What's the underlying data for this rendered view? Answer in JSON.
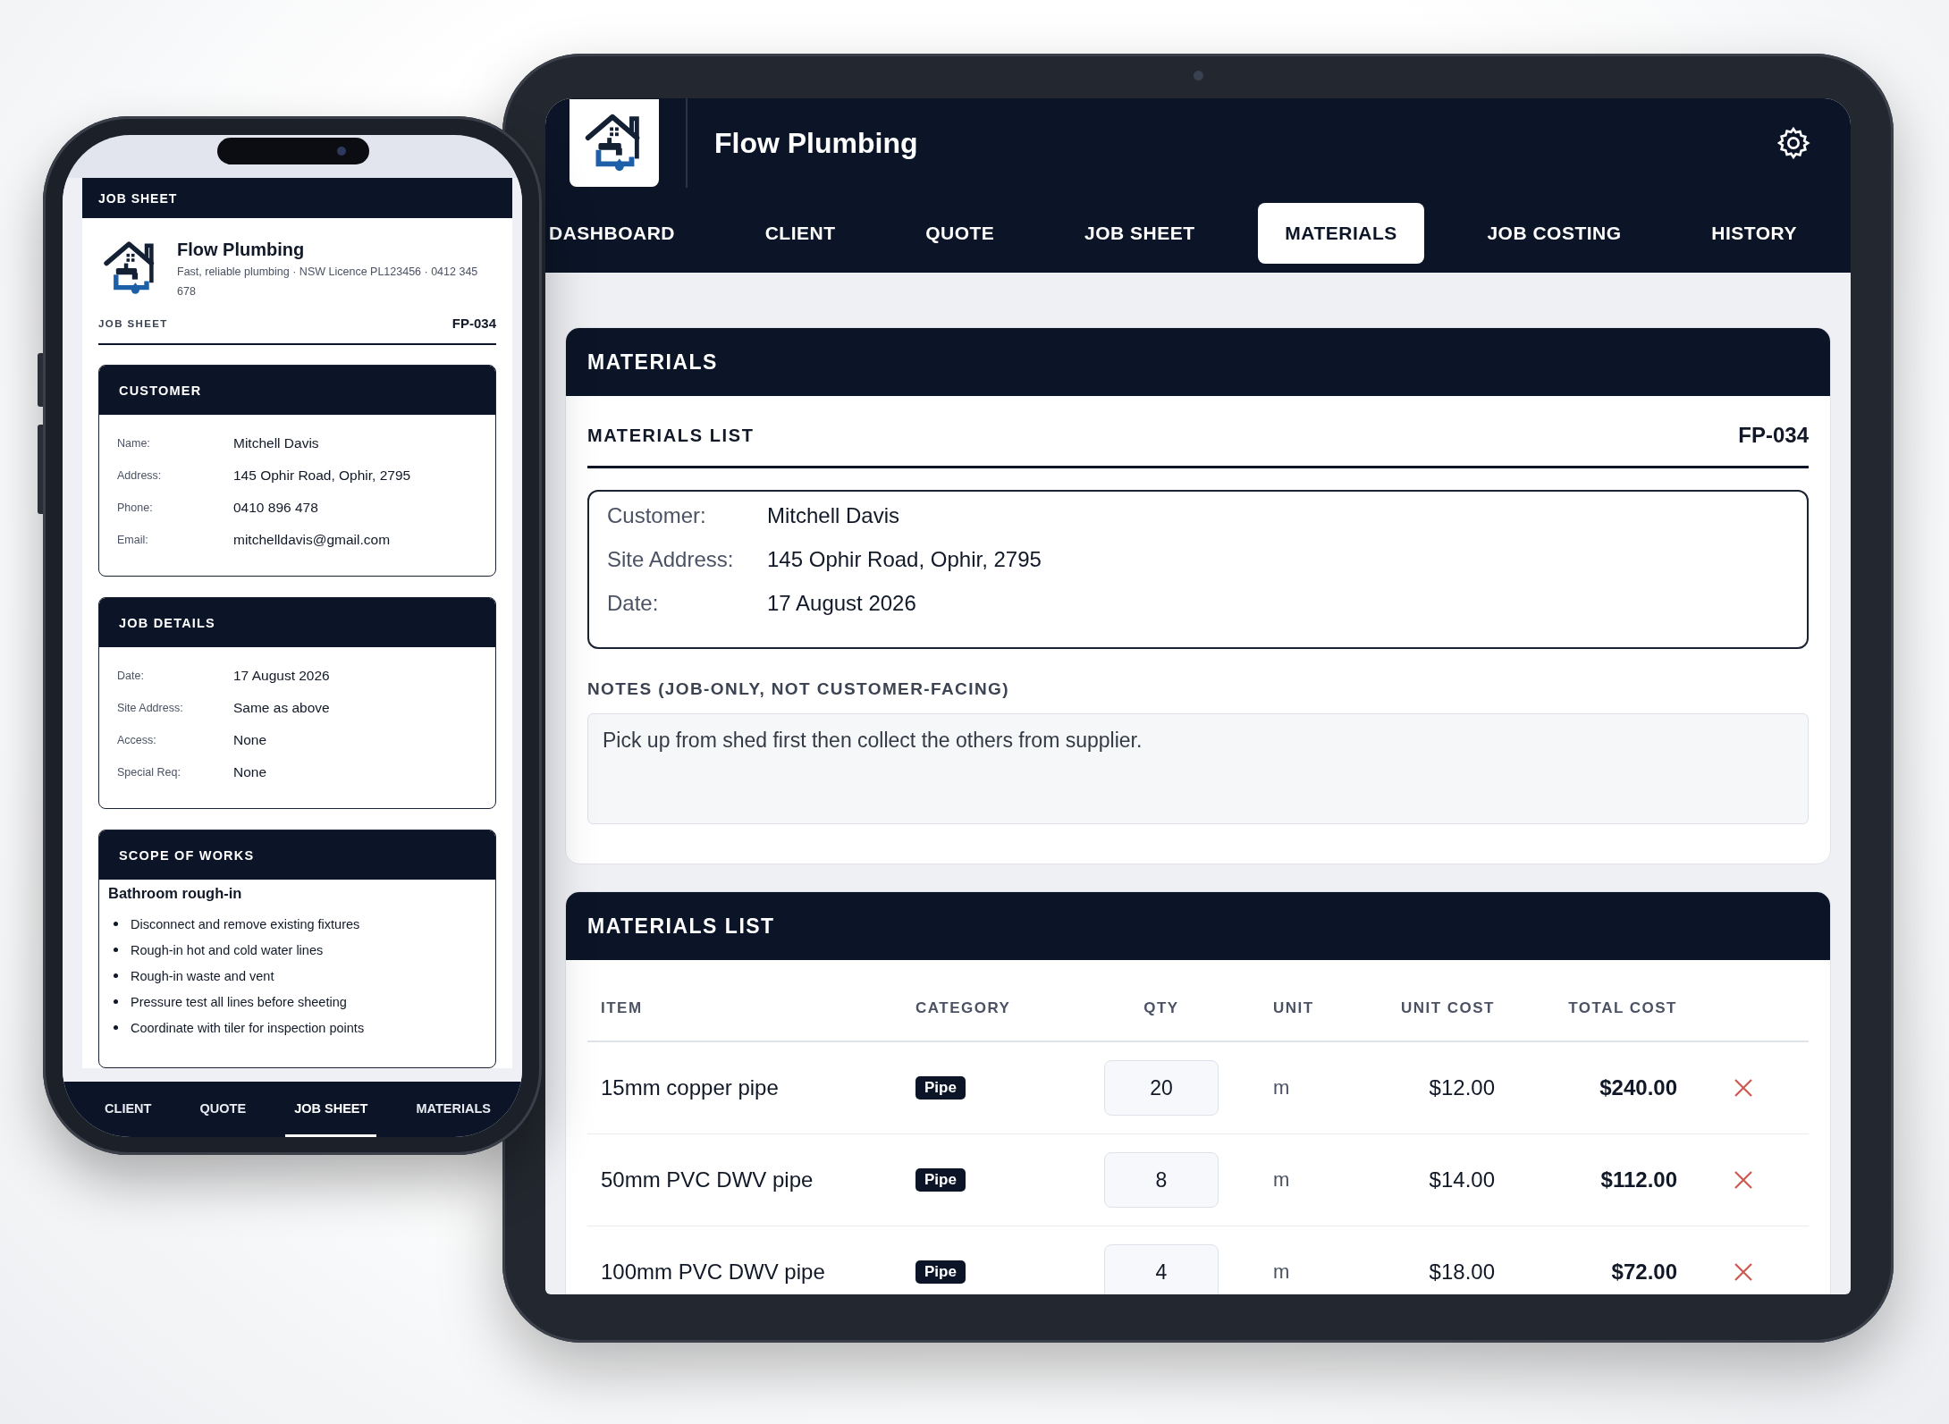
{
  "tablet": {
    "brand": "Flow Plumbing",
    "tabs": [
      {
        "label": "DASHBOARD",
        "selected": false
      },
      {
        "label": "CLIENT",
        "selected": false
      },
      {
        "label": "QUOTE",
        "selected": false
      },
      {
        "label": "JOB SHEET",
        "selected": false
      },
      {
        "label": "MATERIALS",
        "selected": true
      },
      {
        "label": "JOB COSTING",
        "selected": false
      },
      {
        "label": "HISTORY",
        "selected": false
      }
    ],
    "materials_card": {
      "title": "MATERIALS",
      "subtitle": "MATERIALS LIST",
      "job_number": "FP-034",
      "details": [
        {
          "label": "Customer:",
          "value": "Mitchell Davis"
        },
        {
          "label": "Site Address:",
          "value": "145 Ophir Road, Ophir, 2795"
        },
        {
          "label": "Date:",
          "value": "17 August 2026"
        }
      ],
      "notes_label": "NOTES (JOB-ONLY, NOT CUSTOMER-FACING)",
      "notes": "Pick up from shed first then collect the others from supplier."
    },
    "list_card": {
      "title": "MATERIALS LIST",
      "columns": [
        "ITEM",
        "CATEGORY",
        "QTY",
        "UNIT",
        "UNIT COST",
        "TOTAL COST"
      ],
      "rows": [
        {
          "item": "15mm copper pipe",
          "category": "Pipe",
          "qty": "20",
          "unit": "m",
          "unit_cost": "$12.00",
          "total_cost": "$240.00"
        },
        {
          "item": "50mm PVC DWV pipe",
          "category": "Pipe",
          "qty": "8",
          "unit": "m",
          "unit_cost": "$14.00",
          "total_cost": "$112.00"
        },
        {
          "item": "100mm PVC DWV pipe",
          "category": "Pipe",
          "qty": "4",
          "unit": "m",
          "unit_cost": "$18.00",
          "total_cost": "$72.00"
        }
      ]
    }
  },
  "phone": {
    "header": "JOB SHEET",
    "business": "Flow Plumbing",
    "tagline": "Fast, reliable plumbing · NSW Licence PL123456 · 0412 345 678",
    "doc_label": "JOB SHEET",
    "job_number": "FP-034",
    "sections": [
      {
        "title": "CUSTOMER",
        "kind": "fields",
        "fields": [
          {
            "label": "Name:",
            "value": "Mitchell Davis"
          },
          {
            "label": "Address:",
            "value": "145 Ophir Road, Ophir, 2795"
          },
          {
            "label": "Phone:",
            "value": "0410 896 478"
          },
          {
            "label": "Email:",
            "value": "mitchelldavis@gmail.com"
          }
        ]
      },
      {
        "title": "JOB DETAILS",
        "kind": "fields",
        "fields": [
          {
            "label": "Date:",
            "value": "17 August 2026"
          },
          {
            "label": "Site Address:",
            "value": "Same as above"
          },
          {
            "label": "Access:",
            "value": "None"
          },
          {
            "label": "Special Req:",
            "value": "None"
          }
        ]
      },
      {
        "title": "SCOPE OF WORKS",
        "kind": "list",
        "heading": "Bathroom rough-in",
        "items": [
          "Disconnect and remove existing fixtures",
          "Rough-in hot and cold water lines",
          "Rough-in waste and vent",
          "Pressure test all lines before sheeting",
          "Coordinate with tiler for inspection points"
        ]
      }
    ],
    "nav": [
      {
        "label": "CLIENT",
        "selected": false
      },
      {
        "label": "QUOTE",
        "selected": false
      },
      {
        "label": "JOB SHEET",
        "selected": true
      },
      {
        "label": "MATERIALS",
        "selected": false
      }
    ]
  }
}
